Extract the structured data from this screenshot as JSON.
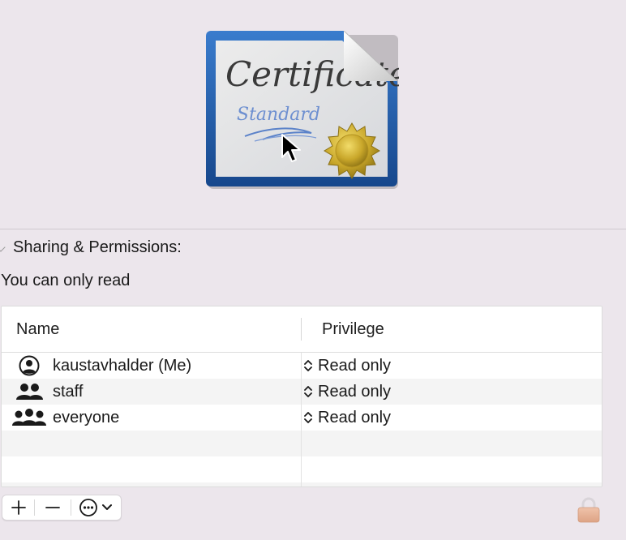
{
  "preview": {
    "certificate_title": "Certificate",
    "certificate_subtitle": "Standard"
  },
  "sharing": {
    "header": "Sharing & Permissions:",
    "access_note": "You can only read",
    "columns": {
      "name": "Name",
      "privilege": "Privilege"
    },
    "rows": [
      {
        "icon": "single-user-icon",
        "name": "kaustavhalder (Me)",
        "privilege": "Read only"
      },
      {
        "icon": "group-icon",
        "name": "staff",
        "privilege": "Read only"
      },
      {
        "icon": "everyone-icon",
        "name": "everyone",
        "privilege": "Read only"
      }
    ]
  },
  "toolbar": {
    "add_icon": "plus-icon",
    "remove_icon": "minus-icon",
    "action_icon": "ellipsis-circle-icon"
  },
  "lock": {
    "icon": "lock-icon"
  },
  "colors": {
    "background": "#ece6ec",
    "certificate_frame": "#1f5ea8",
    "seal_gold": "#c9a72a",
    "lock": "#e8b59c"
  }
}
